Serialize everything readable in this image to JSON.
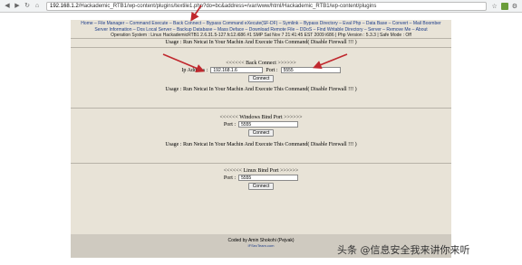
{
  "browser": {
    "url_host": "192.168.1.2",
    "url_path": "/Hackademic_RTB1/wp-content/plugins/textile1.php?do=bc&address=/var/www/html/Hackademic_RTB1/wp-content/plugins"
  },
  "topnav": {
    "line1": "Home – File Manager – Command Execute – Back Connect – Bypass Command eXecute(SF-DF) – Symlink – Bypass Directory – Eval Php – Data Base – Convert – Mail Boomber",
    "line2": "Server Information – Dos Local Server – Backup Database – Mass Deface – Download Remote File – DDoS – Find Writable Directory – Server – Remove Me – About",
    "sysinfo": "Operation System : Linux HackademicRTB1 2.6.31.5-127.fc12.i686 #1 SMP Sat Nov 7 21:41:45 EST 2009 i686 | Php Version : 5.3.3 | Safe Mode : Off"
  },
  "usage_text": "Usage : Run Netcat In Your Machin And Execute This Command( Disable Firewall !!! )",
  "back_connect": {
    "title": "<<<<<< Back Connect >>>>>>",
    "ip_label": "Ip Address :",
    "ip_value": "192.168.1.6",
    "port_label": "Port :",
    "port_value": "5555",
    "button": "Connect"
  },
  "windows_bind": {
    "title": "<<<<<< Windows Bind Port >>>>>>",
    "port_label": "Port :",
    "port_value": "5555",
    "button": "Connect"
  },
  "linux_bind": {
    "title": "<<<<<< Linux Bind Port >>>>>>",
    "port_label": "Port :",
    "port_value": "5555",
    "button": "Connect"
  },
  "footer": {
    "credit": "Coded by Amin Shokohi (Pejvak)",
    "site": "IFSecTeam.com"
  },
  "watermark": "头条 @信息安全我来讲你来听",
  "colors": {
    "page_bg": "#e8e3d7",
    "footer_bg": "#cfcac0",
    "link": "#1c3c8a",
    "arrow": "#c0282e"
  }
}
